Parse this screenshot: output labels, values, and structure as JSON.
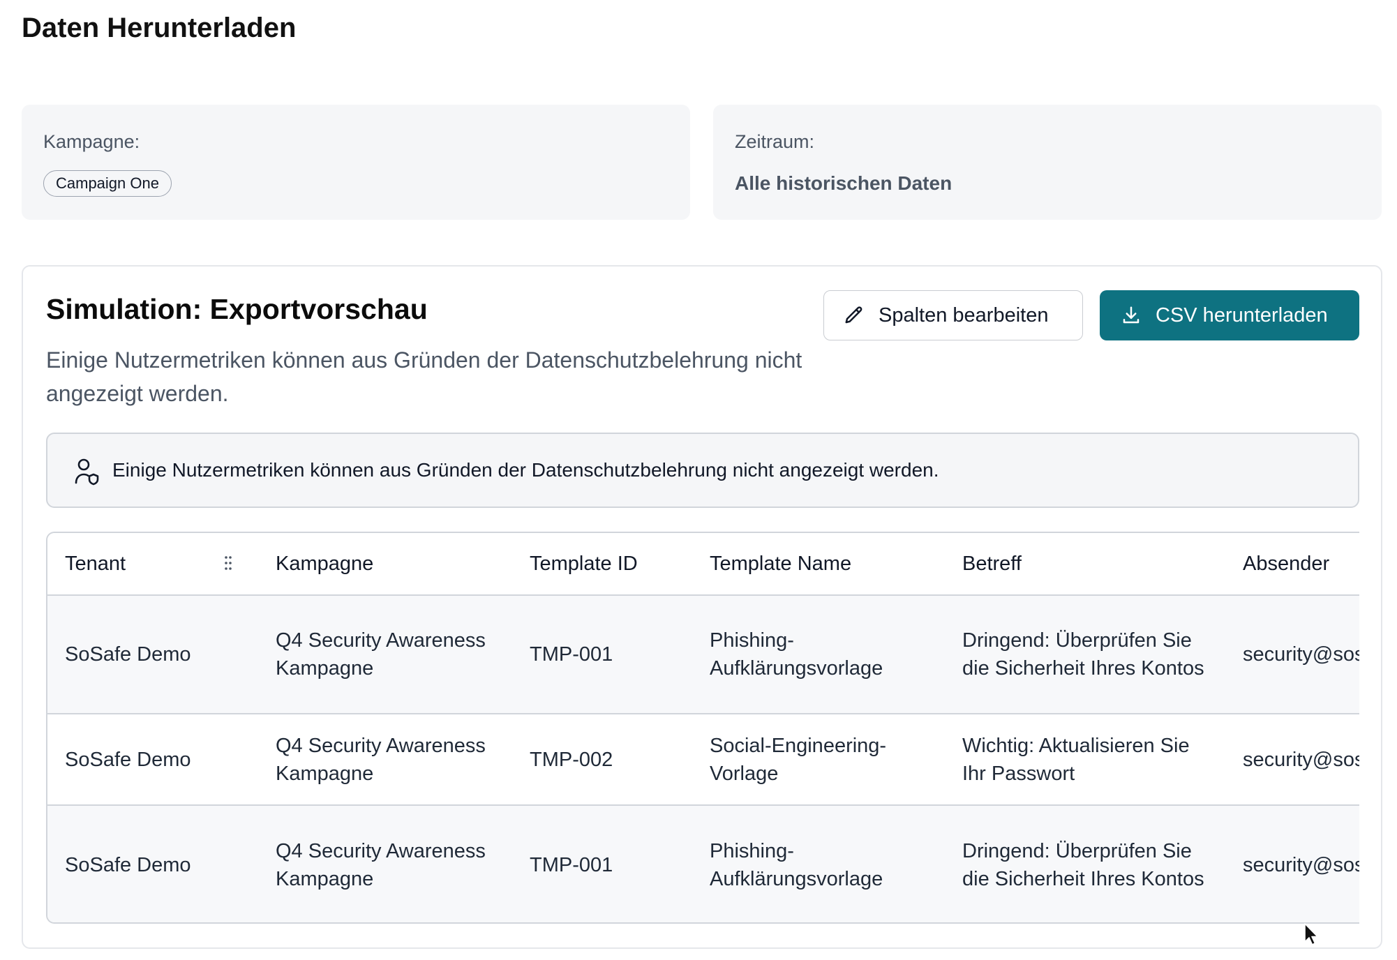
{
  "page": {
    "title": "Daten Herunterladen"
  },
  "filters": {
    "campaign": {
      "label": "Kampagne:",
      "chip": "Campaign One"
    },
    "period": {
      "label": "Zeitraum:",
      "value": "Alle historischen Daten"
    }
  },
  "panel": {
    "title": "Simulation: Exportvorschau",
    "subtitle": "Einige Nutzermetriken können aus Gründen der Datenschutzbelehrung nicht angezeigt werden.",
    "edit_columns_label": "Spalten bearbeiten",
    "download_csv_label": "CSV herunterladen",
    "notice": "Einige Nutzermetriken können aus Gründen der Datenschutzbelehrung nicht angezeigt werden.",
    "primary_color": "#0e7281"
  },
  "table": {
    "columns": [
      "Tenant",
      "Kampagne",
      "Template ID",
      "Template Name",
      "Betreff",
      "Absender"
    ],
    "rows": [
      [
        "SoSafe Demo",
        "Q4 Security Awareness Kampagne",
        "TMP-001",
        "Phishing-Aufklärungsvorlage",
        "Dringend: Überprüfen Sie die Sicherheit Ihres Kontos",
        "security@sos"
      ],
      [
        "SoSafe Demo",
        "Q4 Security Awareness Kampagne",
        "TMP-002",
        "Social-Engineering-Vorlage",
        "Wichtig: Aktualisieren Sie Ihr Passwort",
        "security@sos"
      ],
      [
        "SoSafe Demo",
        "Q4 Security Awareness Kampagne",
        "TMP-001",
        "Phishing-Aufklärungsvorlage",
        "Dringend: Überprüfen Sie die Sicherheit Ihres Kontos",
        "security@sos"
      ]
    ]
  },
  "icons": {
    "edit": "pencil-icon",
    "download": "download-icon",
    "notice": "user-shield-icon",
    "column_handle": "drag-handle-icon",
    "cursor": "mouse-pointer"
  }
}
